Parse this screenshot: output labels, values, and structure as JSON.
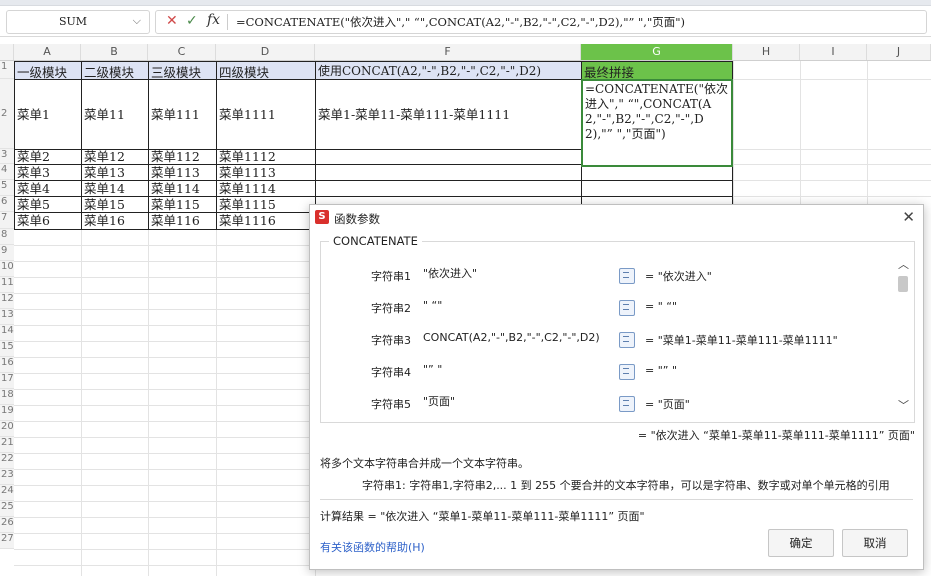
{
  "formula_bar": {
    "name_box": "SUM",
    "cancel_icon": "close-icon",
    "confirm_icon": "check-icon",
    "fx_label": "fx",
    "formula": "=CONCATENATE(\"依次进入\",\" “\",CONCAT(A2,\"-\",B2,\"-\",C2,\"-\",D2),\"” \",\"页面\")"
  },
  "columns": [
    "A",
    "B",
    "C",
    "D",
    "F",
    "G",
    "H",
    "I",
    "J"
  ],
  "rows": [
    "1",
    "2",
    "3",
    "4",
    "5",
    "6",
    "7",
    "8",
    "9",
    "10",
    "11",
    "12",
    "13",
    "14",
    "15",
    "16",
    "17",
    "18",
    "19",
    "20",
    "21",
    "22",
    "23",
    "24",
    "25",
    "26",
    "27"
  ],
  "sheet": {
    "header": [
      "一级模块",
      "二级模块",
      "三级模块",
      "四级模块",
      "使用CONCAT(A2,\"-\",B2,\"-\",C2,\"-\",D2)",
      "最终拼接"
    ],
    "row2": [
      "菜单1",
      "菜单11",
      "菜单111",
      "菜单1111",
      "菜单1-菜单11-菜单111-菜单1111"
    ],
    "row3": [
      "菜单2",
      "菜单12",
      "菜单112",
      "菜单1112"
    ],
    "row4": [
      "菜单3",
      "菜单13",
      "菜单113",
      "菜单1113"
    ],
    "row5": [
      "菜单4",
      "菜单14",
      "菜单114",
      "菜单1114"
    ],
    "row6": [
      "菜单5",
      "菜单15",
      "菜单115",
      "菜单1115"
    ],
    "row7": [
      "菜单6",
      "菜单16",
      "菜单116",
      "菜单1116"
    ],
    "editing_text": "=CONCATENATE(\"依次进入\",\" “\",CONCAT(A2,\"-\",B2,\"-\",C2,\"-\",D2),\"” \",\"页面\")"
  },
  "dialog": {
    "title": "函数参数",
    "function_name": "CONCATENATE",
    "args": [
      {
        "label": "字符串1",
        "input": "\"依次进入\"",
        "value": "= \"依次进入\""
      },
      {
        "label": "字符串2",
        "input": "\" “\"",
        "value": "= \" “\""
      },
      {
        "label": "字符串3",
        "input": "CONCAT(A2,\"-\",B2,\"-\",C2,\"-\",D2)",
        "value": "= \"菜单1-菜单11-菜单111-菜单1111\""
      },
      {
        "label": "字符串4",
        "input": "\"” \"",
        "value": "= \"” \""
      },
      {
        "label": "字符串5",
        "input": "\"页面\"",
        "value": "= \"页面\""
      }
    ],
    "result_preview": "= \"依次进入 “菜单1-菜单11-菜单111-菜单1111” 页面\"",
    "description": "将多个文本字符串合并成一个文本字符串。",
    "arg_description": "字符串1:  字符串1,字符串2,... 1 到 255 个要合并的文本字符串，可以是字符串、数字或对单个单元格的引用",
    "calc_result": "计算结果 = \"依次进入 “菜单1-菜单11-菜单111-菜单1111” 页面\"",
    "help_link": "有关该函数的帮助(H)",
    "ok": "确定",
    "cancel": "取消"
  }
}
